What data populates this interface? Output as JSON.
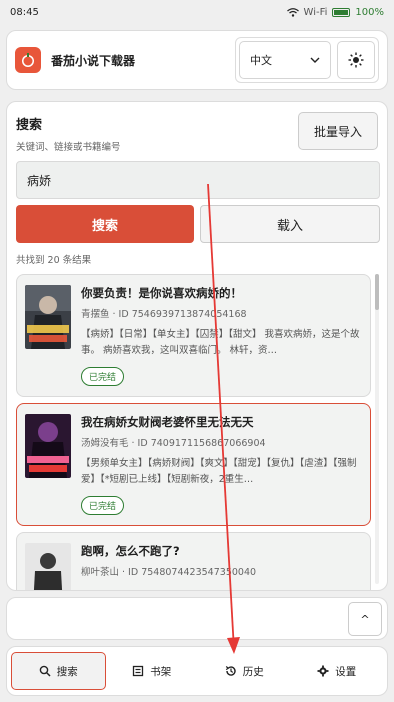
{
  "status_bar": {
    "time": "08:45",
    "wifi": "Wi-Fi",
    "battery": "100%"
  },
  "header": {
    "title": "番茄小说下载器",
    "language": "中文",
    "theme_icon": "sun-icon"
  },
  "search": {
    "title": "搜索",
    "subtitle": "关键词、链接或书籍编号",
    "batch_import": "批量导入",
    "query": "病娇",
    "search_button": "搜索",
    "load_button": "载入",
    "result_count": "共找到 20 条结果"
  },
  "results": [
    {
      "title": "你要负责！是你说喜欢病娇的！",
      "meta": "青摆鱼 · ID 7546939713874054168",
      "desc": "【病娇】【日常】【单女主】【囚禁】【甜文】 我喜欢病娇，这是个故事。 病娇喜欢我，这叫双喜临门。 林轩，资…",
      "status": "已完结"
    },
    {
      "title": "我在病娇女财阀老婆怀里无法无天",
      "meta": "汤姆没有毛 · ID 7409171156867066904",
      "desc": "【男频单女主】【病娇财阀】【爽文】【甜宠】【复仇】【虐渣】【强制爱】【*短剧已上线】【短剧新夜，2重生…",
      "status": "已完结"
    },
    {
      "title": "跑啊，怎么不跑了?",
      "meta": "柳叶茶山 · ID 7548074423547350040",
      "desc": "",
      "status": ""
    }
  ],
  "scroll_top": "^",
  "nav": [
    {
      "label": "搜索",
      "icon": "search-icon"
    },
    {
      "label": "书架",
      "icon": "bookshelf-icon"
    },
    {
      "label": "历史",
      "icon": "history-icon"
    },
    {
      "label": "设置",
      "icon": "gear-icon"
    }
  ],
  "colors": {
    "accent": "#d94e38",
    "success": "#2e7d32",
    "annotation": "#e53935"
  }
}
